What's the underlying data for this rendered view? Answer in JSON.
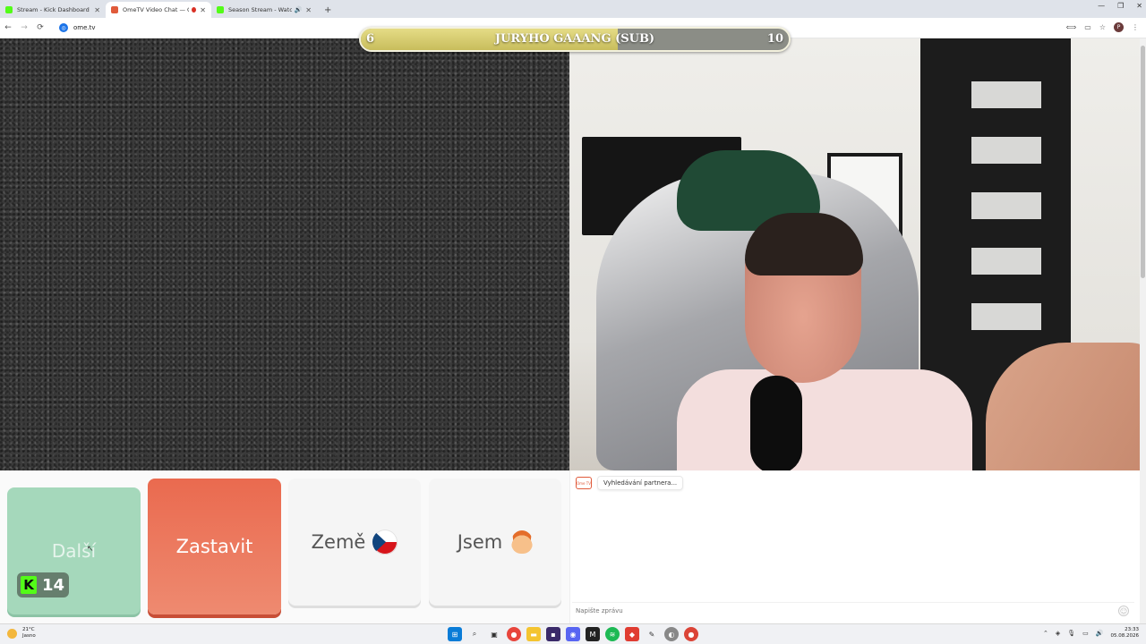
{
  "browser": {
    "tabs": [
      {
        "title": "Stream - Kick Dashboard",
        "favicon_color": "#53fc18",
        "active": false
      },
      {
        "title": "OmeTV Video Chat — Ome",
        "favicon_color": "#e05a3a",
        "active": true,
        "recording": true
      },
      {
        "title": "Season Stream - Watch Live",
        "favicon_color": "#53fc18",
        "active": false,
        "audio": true
      }
    ],
    "new_tab": "+",
    "window_controls": {
      "minimize": "—",
      "restore": "❐",
      "close": "✕"
    },
    "url": "ome.tv",
    "nav": {
      "back": "←",
      "forward": "→",
      "reload": "⟳"
    },
    "profile_initial": "P"
  },
  "goal": {
    "label": "JURYHO GAAANG (SUB)",
    "current": "6",
    "target": "10",
    "progress": 0.6,
    "fill_color": "#e5dc86"
  },
  "controls": {
    "next_label": "Další",
    "stop_label": "Zastavit",
    "country_label": "Země",
    "country_flag": "czech-flag-icon",
    "iam_label": "Jsem",
    "iam_icon": "boy-emoji-icon",
    "kick_count": "14",
    "colors": {
      "next": "#a5d8bb",
      "stop": "#ea6a4f",
      "kick": "#53fc18"
    }
  },
  "chat": {
    "status": "Vyhledávání partnera...",
    "logo_text": "Ome TV",
    "input_placeholder": "Napište zprávu"
  },
  "taskbar": {
    "weather_temp": "21°C",
    "weather_desc": "Jasno",
    "time": "23:33",
    "date": "05.08.2026"
  }
}
